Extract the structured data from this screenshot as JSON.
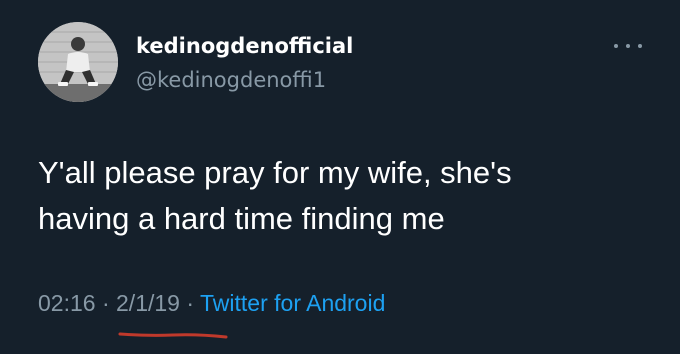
{
  "tweet": {
    "display_name": "kedinogdenofficial",
    "handle": "@kedinogdenoffi1",
    "text_lines": [
      "Y'all please pray for my wife, she's",
      "having a hard time finding me"
    ],
    "time": "02:16",
    "separator": "·",
    "date": "2/1/19",
    "source": "Twitter for Android"
  },
  "icons": {
    "more": "more-horizontal-icon"
  },
  "colors": {
    "background": "#15202b",
    "primary_text": "#ffffff",
    "secondary_text": "#8899a6",
    "link": "#1da1f2",
    "annotation": "#c0392b"
  }
}
